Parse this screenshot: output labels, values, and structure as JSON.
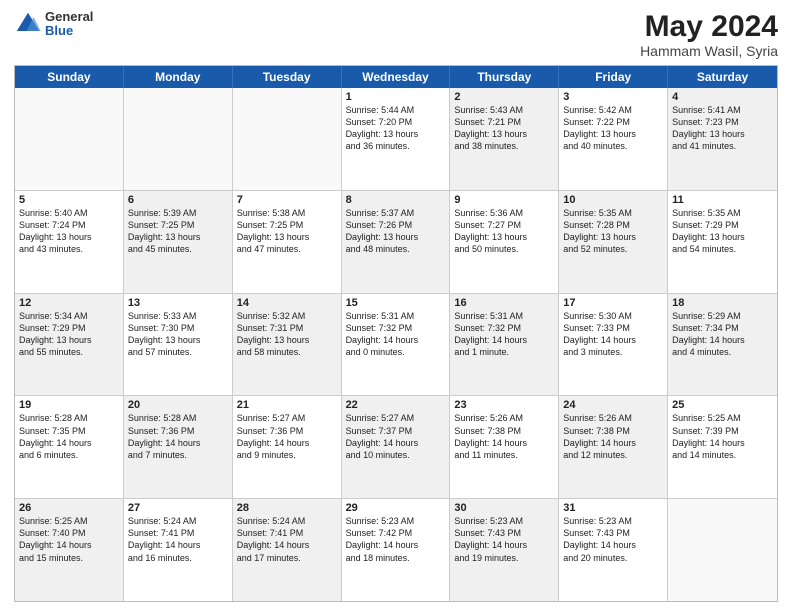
{
  "header": {
    "logo": {
      "general": "General",
      "blue": "Blue"
    },
    "title": "May 2024",
    "subtitle": "Hammam Wasil, Syria"
  },
  "calendar": {
    "days": [
      "Sunday",
      "Monday",
      "Tuesday",
      "Wednesday",
      "Thursday",
      "Friday",
      "Saturday"
    ],
    "rows": [
      [
        {
          "day": "",
          "text": "",
          "empty": true
        },
        {
          "day": "",
          "text": "",
          "empty": true
        },
        {
          "day": "",
          "text": "",
          "empty": true
        },
        {
          "day": "1",
          "text": "Sunrise: 5:44 AM\nSunset: 7:20 PM\nDaylight: 13 hours\nand 36 minutes.",
          "shaded": false
        },
        {
          "day": "2",
          "text": "Sunrise: 5:43 AM\nSunset: 7:21 PM\nDaylight: 13 hours\nand 38 minutes.",
          "shaded": true
        },
        {
          "day": "3",
          "text": "Sunrise: 5:42 AM\nSunset: 7:22 PM\nDaylight: 13 hours\nand 40 minutes.",
          "shaded": false
        },
        {
          "day": "4",
          "text": "Sunrise: 5:41 AM\nSunset: 7:23 PM\nDaylight: 13 hours\nand 41 minutes.",
          "shaded": true
        }
      ],
      [
        {
          "day": "5",
          "text": "Sunrise: 5:40 AM\nSunset: 7:24 PM\nDaylight: 13 hours\nand 43 minutes.",
          "shaded": false
        },
        {
          "day": "6",
          "text": "Sunrise: 5:39 AM\nSunset: 7:25 PM\nDaylight: 13 hours\nand 45 minutes.",
          "shaded": true
        },
        {
          "day": "7",
          "text": "Sunrise: 5:38 AM\nSunset: 7:25 PM\nDaylight: 13 hours\nand 47 minutes.",
          "shaded": false
        },
        {
          "day": "8",
          "text": "Sunrise: 5:37 AM\nSunset: 7:26 PM\nDaylight: 13 hours\nand 48 minutes.",
          "shaded": true
        },
        {
          "day": "9",
          "text": "Sunrise: 5:36 AM\nSunset: 7:27 PM\nDaylight: 13 hours\nand 50 minutes.",
          "shaded": false
        },
        {
          "day": "10",
          "text": "Sunrise: 5:35 AM\nSunset: 7:28 PM\nDaylight: 13 hours\nand 52 minutes.",
          "shaded": true
        },
        {
          "day": "11",
          "text": "Sunrise: 5:35 AM\nSunset: 7:29 PM\nDaylight: 13 hours\nand 54 minutes.",
          "shaded": false
        }
      ],
      [
        {
          "day": "12",
          "text": "Sunrise: 5:34 AM\nSunset: 7:29 PM\nDaylight: 13 hours\nand 55 minutes.",
          "shaded": true
        },
        {
          "day": "13",
          "text": "Sunrise: 5:33 AM\nSunset: 7:30 PM\nDaylight: 13 hours\nand 57 minutes.",
          "shaded": false
        },
        {
          "day": "14",
          "text": "Sunrise: 5:32 AM\nSunset: 7:31 PM\nDaylight: 13 hours\nand 58 minutes.",
          "shaded": true
        },
        {
          "day": "15",
          "text": "Sunrise: 5:31 AM\nSunset: 7:32 PM\nDaylight: 14 hours\nand 0 minutes.",
          "shaded": false
        },
        {
          "day": "16",
          "text": "Sunrise: 5:31 AM\nSunset: 7:32 PM\nDaylight: 14 hours\nand 1 minute.",
          "shaded": true
        },
        {
          "day": "17",
          "text": "Sunrise: 5:30 AM\nSunset: 7:33 PM\nDaylight: 14 hours\nand 3 minutes.",
          "shaded": false
        },
        {
          "day": "18",
          "text": "Sunrise: 5:29 AM\nSunset: 7:34 PM\nDaylight: 14 hours\nand 4 minutes.",
          "shaded": true
        }
      ],
      [
        {
          "day": "19",
          "text": "Sunrise: 5:28 AM\nSunset: 7:35 PM\nDaylight: 14 hours\nand 6 minutes.",
          "shaded": false
        },
        {
          "day": "20",
          "text": "Sunrise: 5:28 AM\nSunset: 7:36 PM\nDaylight: 14 hours\nand 7 minutes.",
          "shaded": true
        },
        {
          "day": "21",
          "text": "Sunrise: 5:27 AM\nSunset: 7:36 PM\nDaylight: 14 hours\nand 9 minutes.",
          "shaded": false
        },
        {
          "day": "22",
          "text": "Sunrise: 5:27 AM\nSunset: 7:37 PM\nDaylight: 14 hours\nand 10 minutes.",
          "shaded": true
        },
        {
          "day": "23",
          "text": "Sunrise: 5:26 AM\nSunset: 7:38 PM\nDaylight: 14 hours\nand 11 minutes.",
          "shaded": false
        },
        {
          "day": "24",
          "text": "Sunrise: 5:26 AM\nSunset: 7:38 PM\nDaylight: 14 hours\nand 12 minutes.",
          "shaded": true
        },
        {
          "day": "25",
          "text": "Sunrise: 5:25 AM\nSunset: 7:39 PM\nDaylight: 14 hours\nand 14 minutes.",
          "shaded": false
        }
      ],
      [
        {
          "day": "26",
          "text": "Sunrise: 5:25 AM\nSunset: 7:40 PM\nDaylight: 14 hours\nand 15 minutes.",
          "shaded": true
        },
        {
          "day": "27",
          "text": "Sunrise: 5:24 AM\nSunset: 7:41 PM\nDaylight: 14 hours\nand 16 minutes.",
          "shaded": false
        },
        {
          "day": "28",
          "text": "Sunrise: 5:24 AM\nSunset: 7:41 PM\nDaylight: 14 hours\nand 17 minutes.",
          "shaded": true
        },
        {
          "day": "29",
          "text": "Sunrise: 5:23 AM\nSunset: 7:42 PM\nDaylight: 14 hours\nand 18 minutes.",
          "shaded": false
        },
        {
          "day": "30",
          "text": "Sunrise: 5:23 AM\nSunset: 7:43 PM\nDaylight: 14 hours\nand 19 minutes.",
          "shaded": true
        },
        {
          "day": "31",
          "text": "Sunrise: 5:23 AM\nSunset: 7:43 PM\nDaylight: 14 hours\nand 20 minutes.",
          "shaded": false
        },
        {
          "day": "",
          "text": "",
          "empty": true
        }
      ]
    ]
  }
}
